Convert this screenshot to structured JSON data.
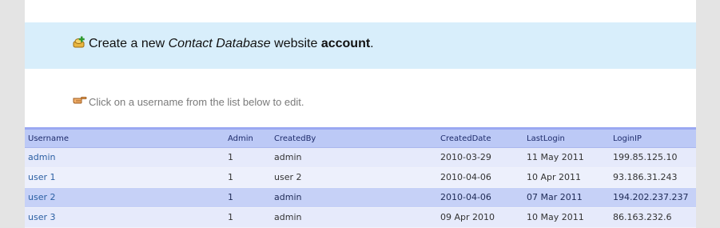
{
  "create_account": {
    "prefix": "Create a new ",
    "italic": "Contact Database",
    "middle": " website ",
    "bold": "account",
    "suffix": ".",
    "icon": "add-user-icon"
  },
  "hint": {
    "text": "Click on a username from the list below to edit.",
    "icon": "pointing-hand-icon"
  },
  "table": {
    "columns": [
      "Username",
      "Admin",
      "CreatedBy",
      "CreatedDate",
      "LastLogin",
      "LoginIP"
    ],
    "rows": [
      {
        "username": "admin",
        "admin": "1",
        "created_by": "admin",
        "created_date": "2010-03-29",
        "last_login": "11 May 2011",
        "login_ip": "199.85.125.10"
      },
      {
        "username": "user 1",
        "admin": "1",
        "created_by": "user 2",
        "created_date": "2010-04-06",
        "last_login": "10 Apr 2011",
        "login_ip": "93.186.31.243"
      },
      {
        "username": "user 2",
        "admin": "1",
        "created_by": "admin",
        "created_date": "2010-04-06",
        "last_login": "07 Mar 2011",
        "login_ip": "194.202.237.237"
      },
      {
        "username": "user 3",
        "admin": "1",
        "created_by": "admin",
        "created_date": "09 Apr 2010",
        "last_login": "10 May 2011",
        "login_ip": "86.163.232.6"
      }
    ]
  },
  "colors": {
    "banner_bg": "#d8eefb",
    "header_bg": "#bcc9f6",
    "row_highlight": "#c6d1f7",
    "link": "#2b5fa3"
  }
}
